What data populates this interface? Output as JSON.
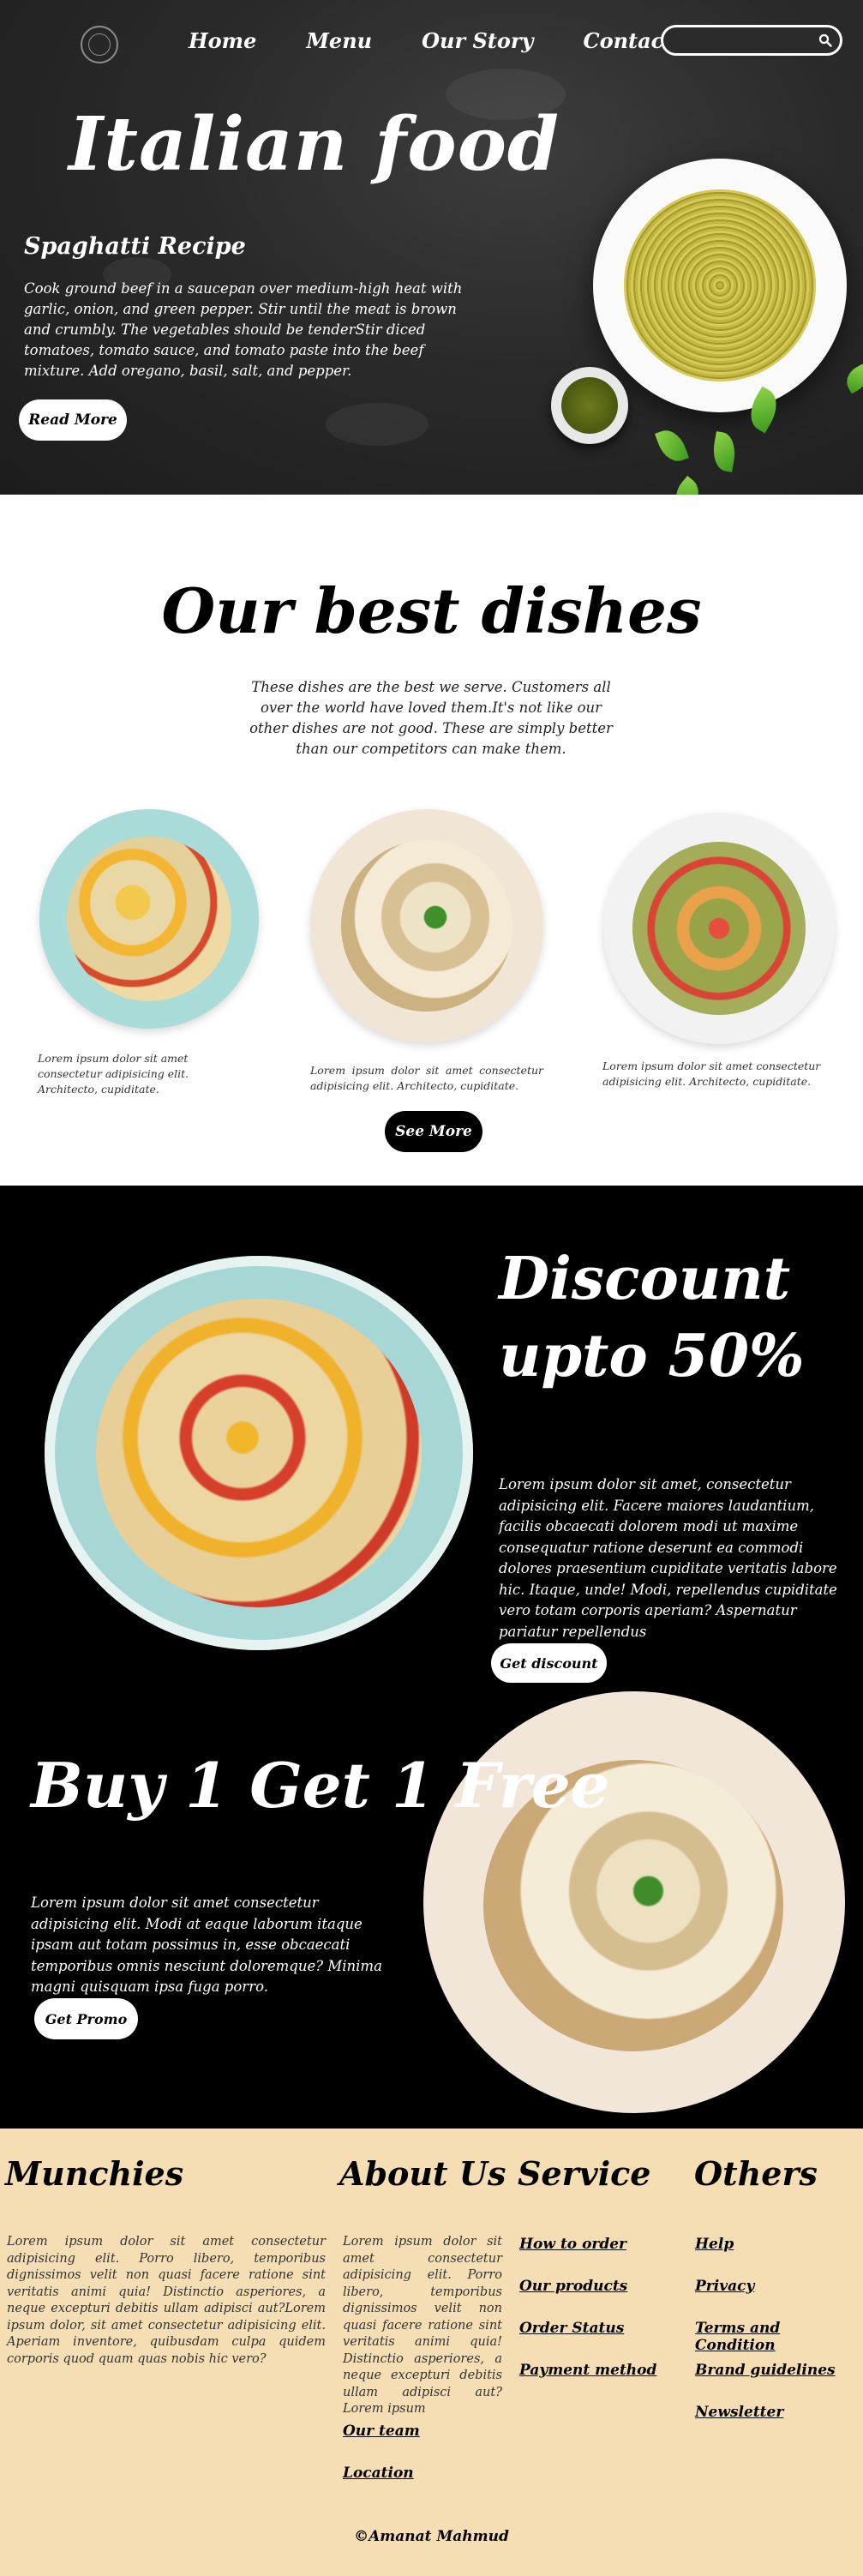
{
  "nav": {
    "links": [
      "Home",
      "Menu",
      "Our Story",
      "Contact Us"
    ],
    "search_placeholder": ""
  },
  "hero": {
    "title": "Italian food",
    "subtitle": "Spaghatti Recipe",
    "text": "Cook ground beef in a saucepan over medium-high heat with garlic, onion, and green pepper. Stir until the meat is brown and crumbly. The vegetables should be tenderStir diced tomatoes, tomato sauce, and tomato paste into the beef mixture. Add oregano, basil, salt, and pepper.",
    "button": "Read More"
  },
  "best": {
    "title": "Our best dishes",
    "description": "These dishes are the best we serve. Customers all over the world have loved them.It's not like our other dishes are not good. These are simply better than our competitors can make them.",
    "captions": [
      "Lorem ipsum dolor sit amet consectetur adipisicing elit. Architecto, cupiditate.",
      "Lorem ipsum dolor sit amet consectetur adipisicing elit. Architecto, cupiditate.",
      "Lorem ipsum dolor sit amet consectetur adipisicing elit. Architecto, cupiditate."
    ],
    "button": "See More"
  },
  "discount": {
    "title": "Discount upto 50%",
    "text": "Lorem ipsum dolor sit amet, consectetur adipisicing elit. Facere maiores laudantium, facilis obcaecati dolorem modi ut maxime consequatur ratione deserunt ea commodi dolores praesentium cupiditate veritatis labore hic. Itaque, unde! Modi, repellendus cupiditate vero totam corporis aperiam? Aspernatur pariatur repellendus",
    "button": "Get discount"
  },
  "bogo": {
    "title": "Buy 1 Get 1 Free",
    "text": "Lorem ipsum dolor sit amet consectetur adipisicing elit. Modi at eaque laborum itaque ipsam aut totam possimus in, esse obcaecati temporibus omnis nesciunt doloremque? Minima magni quisquam ipsa fuga porro.",
    "button": "Get Promo"
  },
  "footer": {
    "munchies": {
      "title": "Munchies",
      "text": "Lorem ipsum dolor sit amet consectetur adipisicing elit. Porro libero, temporibus dignissimos velit non quasi facere ratione sint veritatis animi quia! Distinctio asperiores, a neque excepturi debitis ullam adipisci aut?Lorem ipsum dolor, sit amet consectetur adipisicing elit. Aperiam inventore, quibusdam culpa quidem corporis quod quam quas nobis hic vero?"
    },
    "about": {
      "title": "About Us",
      "text": "Lorem ipsum dolor sit amet consectetur adipisicing elit. Porro libero, temporibus dignissimos velit non quasi facere ratione sint veritatis animi quia! Distinctio asperiores, a neque excepturi debitis ullam adipisci aut? Lorem ipsum",
      "links": [
        "Our team",
        "Location"
      ]
    },
    "service": {
      "title": "Service",
      "links": [
        "How to order",
        "Our products",
        "Order Status",
        "Payment method"
      ]
    },
    "others": {
      "title": "Others",
      "links": [
        "Help",
        "Privacy",
        "Terms and Condition",
        "Brand guidelines",
        "Newsletter"
      ]
    },
    "copyright": "©Amanat Mahmud"
  }
}
